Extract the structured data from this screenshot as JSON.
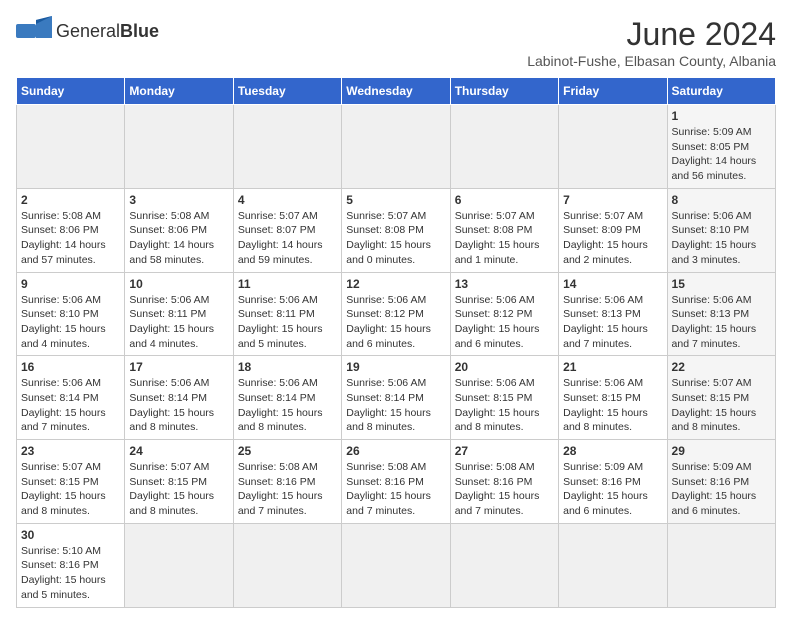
{
  "header": {
    "logo_text_normal": "General",
    "logo_text_bold": "Blue",
    "month_year": "June 2024",
    "location": "Labinot-Fushe, Elbasan County, Albania"
  },
  "weekdays": [
    "Sunday",
    "Monday",
    "Tuesday",
    "Wednesday",
    "Thursday",
    "Friday",
    "Saturday"
  ],
  "days": [
    {
      "num": "",
      "info": "",
      "empty": true
    },
    {
      "num": "",
      "info": "",
      "empty": true
    },
    {
      "num": "",
      "info": "",
      "empty": true
    },
    {
      "num": "",
      "info": "",
      "empty": true
    },
    {
      "num": "",
      "info": "",
      "empty": true
    },
    {
      "num": "",
      "info": "",
      "empty": true
    },
    {
      "num": "1",
      "info": "Sunrise: 5:09 AM\nSunset: 8:05 PM\nDaylight: 14 hours\nand 56 minutes.",
      "shade": true
    },
    {
      "num": "2",
      "info": "Sunrise: 5:08 AM\nSunset: 8:06 PM\nDaylight: 14 hours\nand 57 minutes."
    },
    {
      "num": "3",
      "info": "Sunrise: 5:08 AM\nSunset: 8:06 PM\nDaylight: 14 hours\nand 58 minutes."
    },
    {
      "num": "4",
      "info": "Sunrise: 5:07 AM\nSunset: 8:07 PM\nDaylight: 14 hours\nand 59 minutes."
    },
    {
      "num": "5",
      "info": "Sunrise: 5:07 AM\nSunset: 8:08 PM\nDaylight: 15 hours\nand 0 minutes."
    },
    {
      "num": "6",
      "info": "Sunrise: 5:07 AM\nSunset: 8:08 PM\nDaylight: 15 hours\nand 1 minute."
    },
    {
      "num": "7",
      "info": "Sunrise: 5:07 AM\nSunset: 8:09 PM\nDaylight: 15 hours\nand 2 minutes."
    },
    {
      "num": "8",
      "info": "Sunrise: 5:06 AM\nSunset: 8:10 PM\nDaylight: 15 hours\nand 3 minutes.",
      "shade": true
    },
    {
      "num": "9",
      "info": "Sunrise: 5:06 AM\nSunset: 8:10 PM\nDaylight: 15 hours\nand 4 minutes."
    },
    {
      "num": "10",
      "info": "Sunrise: 5:06 AM\nSunset: 8:11 PM\nDaylight: 15 hours\nand 4 minutes."
    },
    {
      "num": "11",
      "info": "Sunrise: 5:06 AM\nSunset: 8:11 PM\nDaylight: 15 hours\nand 5 minutes."
    },
    {
      "num": "12",
      "info": "Sunrise: 5:06 AM\nSunset: 8:12 PM\nDaylight: 15 hours\nand 6 minutes."
    },
    {
      "num": "13",
      "info": "Sunrise: 5:06 AM\nSunset: 8:12 PM\nDaylight: 15 hours\nand 6 minutes."
    },
    {
      "num": "14",
      "info": "Sunrise: 5:06 AM\nSunset: 8:13 PM\nDaylight: 15 hours\nand 7 minutes."
    },
    {
      "num": "15",
      "info": "Sunrise: 5:06 AM\nSunset: 8:13 PM\nDaylight: 15 hours\nand 7 minutes.",
      "shade": true
    },
    {
      "num": "16",
      "info": "Sunrise: 5:06 AM\nSunset: 8:14 PM\nDaylight: 15 hours\nand 7 minutes."
    },
    {
      "num": "17",
      "info": "Sunrise: 5:06 AM\nSunset: 8:14 PM\nDaylight: 15 hours\nand 8 minutes."
    },
    {
      "num": "18",
      "info": "Sunrise: 5:06 AM\nSunset: 8:14 PM\nDaylight: 15 hours\nand 8 minutes."
    },
    {
      "num": "19",
      "info": "Sunrise: 5:06 AM\nSunset: 8:14 PM\nDaylight: 15 hours\nand 8 minutes."
    },
    {
      "num": "20",
      "info": "Sunrise: 5:06 AM\nSunset: 8:15 PM\nDaylight: 15 hours\nand 8 minutes."
    },
    {
      "num": "21",
      "info": "Sunrise: 5:06 AM\nSunset: 8:15 PM\nDaylight: 15 hours\nand 8 minutes."
    },
    {
      "num": "22",
      "info": "Sunrise: 5:07 AM\nSunset: 8:15 PM\nDaylight: 15 hours\nand 8 minutes.",
      "shade": true
    },
    {
      "num": "23",
      "info": "Sunrise: 5:07 AM\nSunset: 8:15 PM\nDaylight: 15 hours\nand 8 minutes."
    },
    {
      "num": "24",
      "info": "Sunrise: 5:07 AM\nSunset: 8:15 PM\nDaylight: 15 hours\nand 8 minutes."
    },
    {
      "num": "25",
      "info": "Sunrise: 5:08 AM\nSunset: 8:16 PM\nDaylight: 15 hours\nand 7 minutes."
    },
    {
      "num": "26",
      "info": "Sunrise: 5:08 AM\nSunset: 8:16 PM\nDaylight: 15 hours\nand 7 minutes."
    },
    {
      "num": "27",
      "info": "Sunrise: 5:08 AM\nSunset: 8:16 PM\nDaylight: 15 hours\nand 7 minutes."
    },
    {
      "num": "28",
      "info": "Sunrise: 5:09 AM\nSunset: 8:16 PM\nDaylight: 15 hours\nand 6 minutes."
    },
    {
      "num": "29",
      "info": "Sunrise: 5:09 AM\nSunset: 8:16 PM\nDaylight: 15 hours\nand 6 minutes.",
      "shade": true
    },
    {
      "num": "30",
      "info": "Sunrise: 5:10 AM\nSunset: 8:16 PM\nDaylight: 15 hours\nand 5 minutes."
    },
    {
      "num": "",
      "info": "",
      "empty": true
    },
    {
      "num": "",
      "info": "",
      "empty": true
    },
    {
      "num": "",
      "info": "",
      "empty": true
    },
    {
      "num": "",
      "info": "",
      "empty": true
    },
    {
      "num": "",
      "info": "",
      "empty": true
    },
    {
      "num": "",
      "info": "",
      "empty": true
    }
  ]
}
